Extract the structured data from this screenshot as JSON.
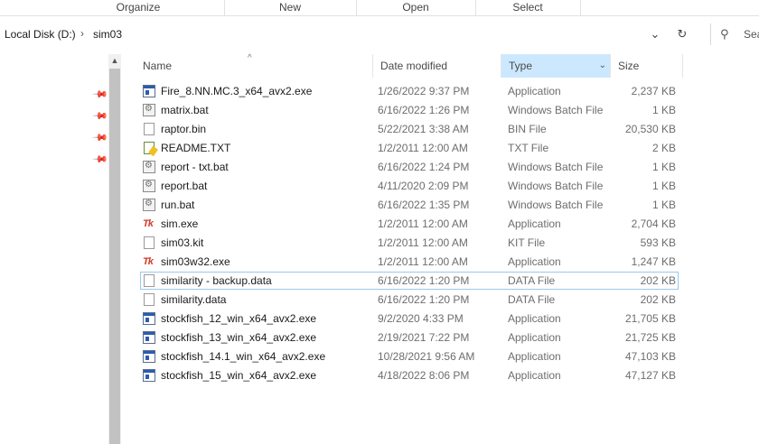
{
  "ribbon": {
    "groups": [
      "Organize",
      "New",
      "Open",
      "Select"
    ]
  },
  "address": {
    "crumbs": [
      "Local Disk (D:)",
      "sim03"
    ],
    "separator": "›",
    "search_placeholder": "Sea"
  },
  "columns": {
    "name": "Name",
    "date": "Date modified",
    "type": "Type",
    "size": "Size"
  },
  "files": [
    {
      "name": "Fire_8.NN.MC.3_x64_avx2.exe",
      "date": "1/26/2022 9:37 PM",
      "type": "Application",
      "size": "2,237 KB",
      "icon": "application-icon"
    },
    {
      "name": "matrix.bat",
      "date": "6/16/2022 1:26 PM",
      "type": "Windows Batch File",
      "size": "1 KB",
      "icon": "batch-file-icon"
    },
    {
      "name": "raptor.bin",
      "date": "5/22/2021 3:38 AM",
      "type": "BIN File",
      "size": "20,530 KB",
      "icon": "file-icon"
    },
    {
      "name": "README.TXT",
      "date": "1/2/2011 12:00 AM",
      "type": "TXT File",
      "size": "2 KB",
      "icon": "text-file-icon"
    },
    {
      "name": "report - txt.bat",
      "date": "6/16/2022 1:24 PM",
      "type": "Windows Batch File",
      "size": "1 KB",
      "icon": "batch-file-icon"
    },
    {
      "name": "report.bat",
      "date": "4/11/2020 2:09 PM",
      "type": "Windows Batch File",
      "size": "1 KB",
      "icon": "batch-file-icon"
    },
    {
      "name": "run.bat",
      "date": "6/16/2022 1:35 PM",
      "type": "Windows Batch File",
      "size": "1 KB",
      "icon": "batch-file-icon"
    },
    {
      "name": "sim.exe",
      "date": "1/2/2011 12:00 AM",
      "type": "Application",
      "size": "2,704 KB",
      "icon": "tk-app-icon"
    },
    {
      "name": "sim03.kit",
      "date": "1/2/2011 12:00 AM",
      "type": "KIT File",
      "size": "593 KB",
      "icon": "file-icon"
    },
    {
      "name": "sim03w32.exe",
      "date": "1/2/2011 12:00 AM",
      "type": "Application",
      "size": "1,247 KB",
      "icon": "tk-app-icon"
    },
    {
      "name": "similarity - backup.data",
      "date": "6/16/2022 1:20 PM",
      "type": "DATA File",
      "size": "202 KB",
      "icon": "file-icon"
    },
    {
      "name": "similarity.data",
      "date": "6/16/2022 1:20 PM",
      "type": "DATA File",
      "size": "202 KB",
      "icon": "file-icon"
    },
    {
      "name": "stockfish_12_win_x64_avx2.exe",
      "date": "9/2/2020 4:33 PM",
      "type": "Application",
      "size": "21,705 KB",
      "icon": "application-icon"
    },
    {
      "name": "stockfish_13_win_x64_avx2.exe",
      "date": "2/19/2021 7:22 PM",
      "type": "Application",
      "size": "21,725 KB",
      "icon": "application-icon"
    },
    {
      "name": "stockfish_14.1_win_x64_avx2.exe",
      "date": "10/28/2021 9:56 AM",
      "type": "Application",
      "size": "47,103 KB",
      "icon": "application-icon"
    },
    {
      "name": "stockfish_15_win_x64_avx2.exe",
      "date": "4/18/2022 8:06 PM",
      "type": "Application",
      "size": "47,127 KB",
      "icon": "application-icon"
    }
  ],
  "icon_glyphs": {
    "tk": "Tk"
  }
}
